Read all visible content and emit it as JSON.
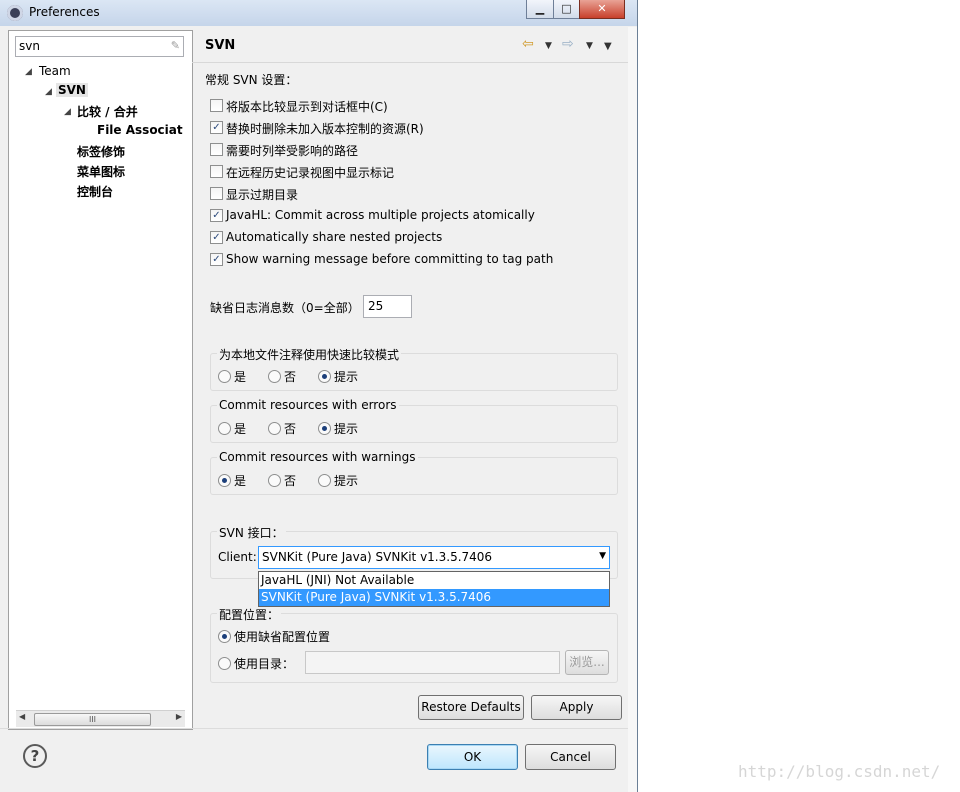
{
  "window": {
    "title": "Preferences",
    "minimize": "▁",
    "maximize": "□",
    "close": "✕"
  },
  "sidebar": {
    "search_value": "svn",
    "search_clear_icon": "eraser-icon",
    "tree": [
      {
        "label": "Team",
        "arrow": "◢"
      },
      {
        "label": "SVN",
        "arrow": "◢"
      },
      {
        "label": "比较 / 合并",
        "arrow": "◢"
      },
      {
        "label": "File Associations"
      },
      {
        "label": "标签修饰"
      },
      {
        "label": "菜单图标"
      },
      {
        "label": "控制台"
      }
    ],
    "hscroll_grip": "III"
  },
  "page": {
    "title": "SVN",
    "section_label": "常规 SVN 设置：",
    "checkboxes": [
      {
        "label": "将版本比较显示到对话框中(C)",
        "checked": false
      },
      {
        "label": "替换时删除未加入版本控制的资源(R)",
        "checked": true
      },
      {
        "label": "需要时列举受影响的路径",
        "checked": false
      },
      {
        "label": "在远程历史记录视图中显示标记",
        "checked": false
      },
      {
        "label": "显示过期目录",
        "checked": false
      },
      {
        "label": "JavaHL: Commit across multiple projects atomically",
        "checked": true
      },
      {
        "label": "Automatically share nested projects",
        "checked": true
      },
      {
        "label": "Show warning message before committing to tag path",
        "checked": true
      }
    ],
    "log_count_label": "缺省日志消息数（0=全部）",
    "log_count_value": "25",
    "groups": [
      {
        "title": "为本地文件注释使用快速比较模式",
        "options": [
          "是",
          "否",
          "提示"
        ],
        "selected": 2
      },
      {
        "title": "Commit resources with errors",
        "options": [
          "是",
          "否",
          "提示"
        ],
        "selected": 2
      },
      {
        "title": "Commit resources with warnings",
        "options": [
          "是",
          "否",
          "提示"
        ],
        "selected": 0
      }
    ],
    "svn_interface": {
      "title": "SVN 接口：",
      "client_label": "Client:",
      "client_value": "SVNKit (Pure Java) SVNKit v1.3.5.7406",
      "options": [
        "JavaHL (JNI) Not Available",
        "SVNKit (Pure Java) SVNKit v1.3.5.7406"
      ],
      "highlighted": 1
    },
    "config": {
      "title": "配置位置：",
      "default_label": "使用缺省配置位置",
      "dir_label": "使用目录：",
      "dir_value": "",
      "browse_label": "浏览..."
    },
    "restore_defaults": "Restore Defaults",
    "apply": "Apply"
  },
  "footer": {
    "ok": "OK",
    "cancel": "Cancel",
    "help_icon": "help-icon"
  },
  "watermark": "http://blog.csdn.net/"
}
